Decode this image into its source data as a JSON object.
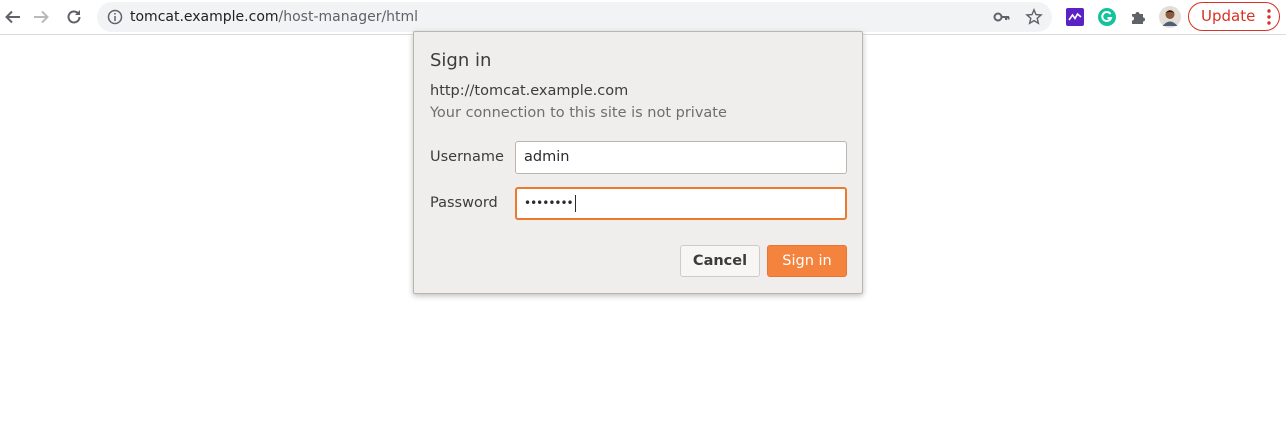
{
  "browser": {
    "url_host": "tomcat.example.com",
    "url_path": "/host-manager/html",
    "update_label": "Update"
  },
  "dialog": {
    "title": "Sign in",
    "origin": "http://tomcat.example.com",
    "warning": "Your connection to this site is not private",
    "username_label": "Username",
    "username_value": "admin",
    "password_label": "Password",
    "password_masked": "••••••••",
    "cancel_label": "Cancel",
    "signin_label": "Sign in"
  },
  "colors": {
    "accent": "#f4843d",
    "update_red": "#d93025"
  }
}
